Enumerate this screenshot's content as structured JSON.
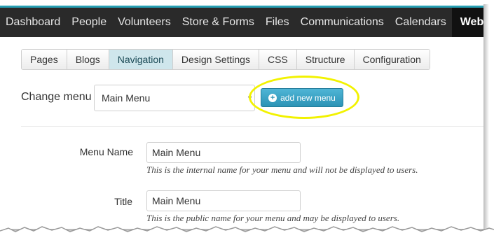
{
  "topnav": {
    "items": [
      "Dashboard",
      "People",
      "Volunteers",
      "Store & Forms",
      "Files",
      "Communications",
      "Calendars",
      "Website"
    ],
    "active": "Website"
  },
  "tabs": [
    "Pages",
    "Blogs",
    "Navigation",
    "Design Settings",
    "CSS",
    "Structure",
    "Configuration"
  ],
  "active_tab": "Navigation",
  "change_menu": {
    "label": "Change menu",
    "selected": "Main Menu",
    "add_button": "add new menu"
  },
  "form": {
    "menu_name": {
      "label": "Menu Name",
      "value": "Main Menu",
      "help": "This is the internal name for your menu and will not be displayed to users."
    },
    "title": {
      "label": "Title",
      "value": "Main Menu",
      "help": "This is the public name for your menu and may be displayed to users."
    }
  },
  "colors": {
    "accent": "#27a0b4",
    "button": "#2c93b5",
    "highlight": "#f2f200",
    "nav_bg": "#2a2a2a"
  }
}
